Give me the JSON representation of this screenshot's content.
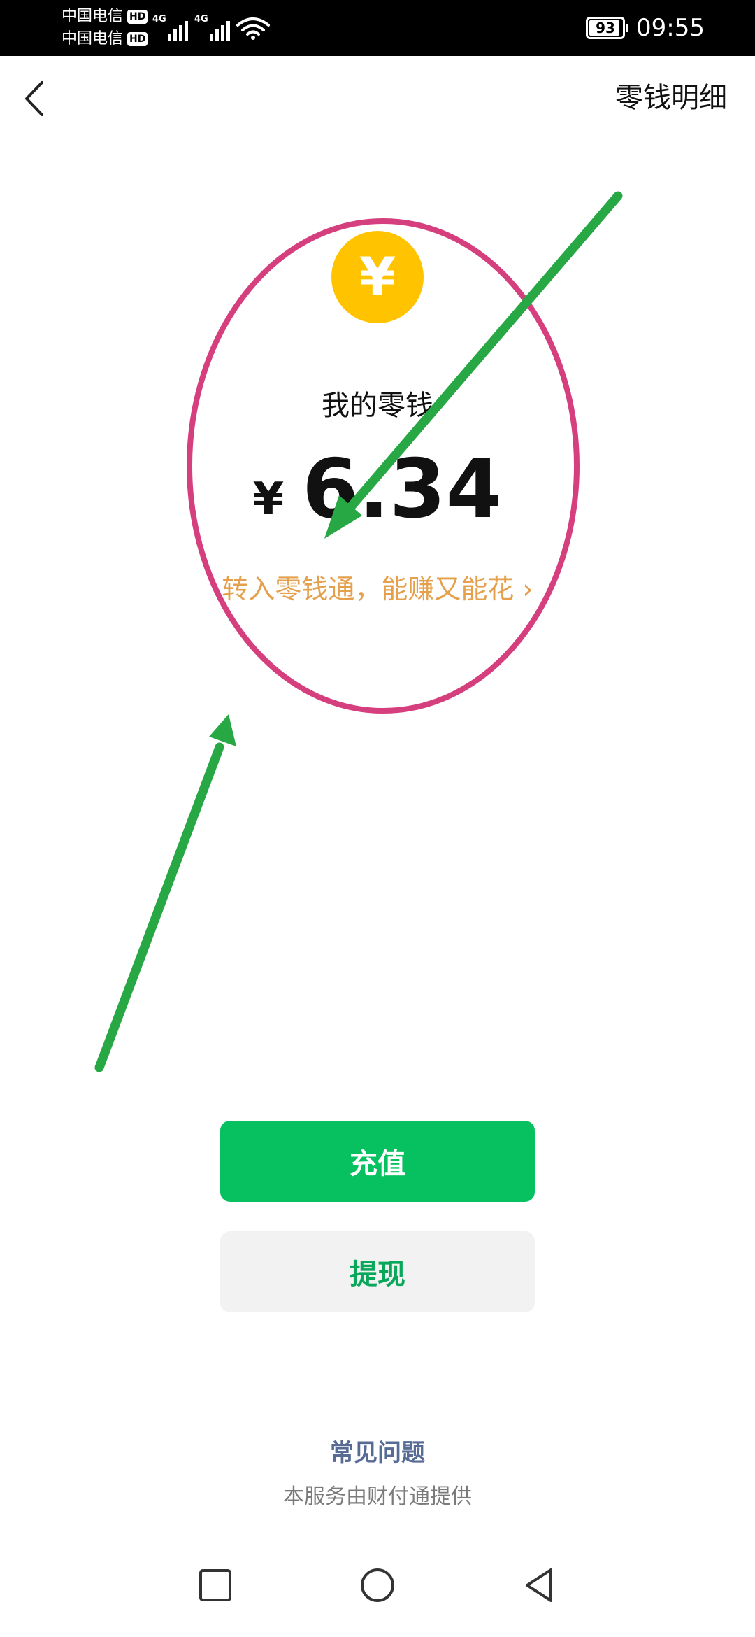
{
  "status_bar": {
    "carriers": [
      {
        "name": "中国电信",
        "badge": "HD"
      },
      {
        "name": "中国电信",
        "badge": "HD"
      }
    ],
    "network_tags": [
      "4G",
      "4G"
    ],
    "battery_level": "93",
    "battery_percent": 93,
    "time": "09:55"
  },
  "nav": {
    "back_icon": "chevron-left-icon",
    "details_link": "零钱明细"
  },
  "balance": {
    "coin_symbol": "¥",
    "label": "我的零钱",
    "currency": "¥",
    "amount": "6.34",
    "promo_text": "转入零钱通，能赚又能花",
    "promo_chevron": "›"
  },
  "actions": {
    "recharge_label": "充值",
    "withdraw_label": "提现"
  },
  "footer": {
    "faq_label": "常见问题",
    "provider_text": "本服务由财付通提供"
  },
  "colors": {
    "primary_green": "#07C160",
    "coin_yellow": "#FFC300",
    "promo_orange": "#E4A04C",
    "link_blue": "#576B95",
    "annotation_circle": "#D63F7D",
    "annotation_arrow": "#28A745"
  }
}
